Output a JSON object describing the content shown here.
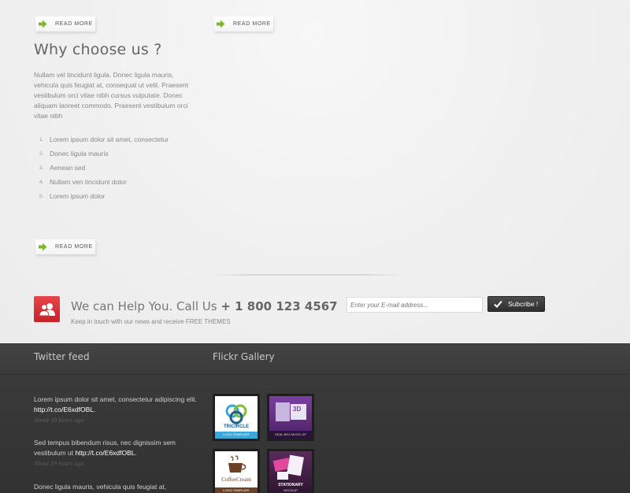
{
  "read_more": {
    "label": "READ MORE"
  },
  "why": {
    "title": "Why choose us ?",
    "text": "Nullam vel tincidunt ligula. Donec ligula mauris, vehicula quis feugiat at, consequat ut velit. Praesent vestibulum orci vitae nibh cursus vulputate. Donec aliquam laoreet commodo. Praesent vestibulum orci vitae nibh",
    "list": [
      {
        "num": "1.",
        "text": "Lorem ipsum dolor sit amet, consectetur"
      },
      {
        "num": "2.",
        "text": "Donec ligula mauris"
      },
      {
        "num": "3.",
        "text": "Aenean sed"
      },
      {
        "num": "4.",
        "text": "Nullam ven tincidunt dolor"
      },
      {
        "num": "5.",
        "text": "Lorem ipsum dolor"
      }
    ]
  },
  "help": {
    "title_prefix": "We can Help You. Call Us ",
    "phone": "+ 1 800 123 4567",
    "subtitle": "Keep in touch with our news and receive FREE THEMES",
    "email_placeholder": "Enter your E-mail address...",
    "subscribe_label": "Subcribe !"
  },
  "footer": {
    "twitter_title": "Twitter feed",
    "flickr_title": "Flickr Gallery",
    "tweets": [
      {
        "text": "Lorem ipsum dolor sit amet, consectetur adipiscing elit. ",
        "link": "http://t.co/E6xdfOBL",
        "after": ".",
        "time": "About 18 hours ago"
      },
      {
        "text": "Sed tempus bibendum risus, nec dignissim sem vestibulum ut ",
        "link": "http://t.co/E6xdfOBL",
        "after": ".",
        "time": "About 19 hours ago"
      },
      {
        "text": "Donec ligula mauris, vehicula quis feugiat at,",
        "link": "",
        "after": "",
        "time": ""
      }
    ],
    "thumbs": [
      {
        "name": "TRICIRCLE",
        "caption": "LOGO TEMPLATE"
      },
      {
        "name": "3D",
        "caption": "DEAL BOX MOCK-UP"
      },
      {
        "name": "CoffeeCream",
        "caption": "LOGO TEMPLATE"
      },
      {
        "name": "STATIONARY",
        "caption": "MOCKUP"
      }
    ]
  },
  "colors": {
    "accent_red": "#d9323a",
    "footer_bg": "#383838",
    "arrow_green": "#7cb82f"
  }
}
